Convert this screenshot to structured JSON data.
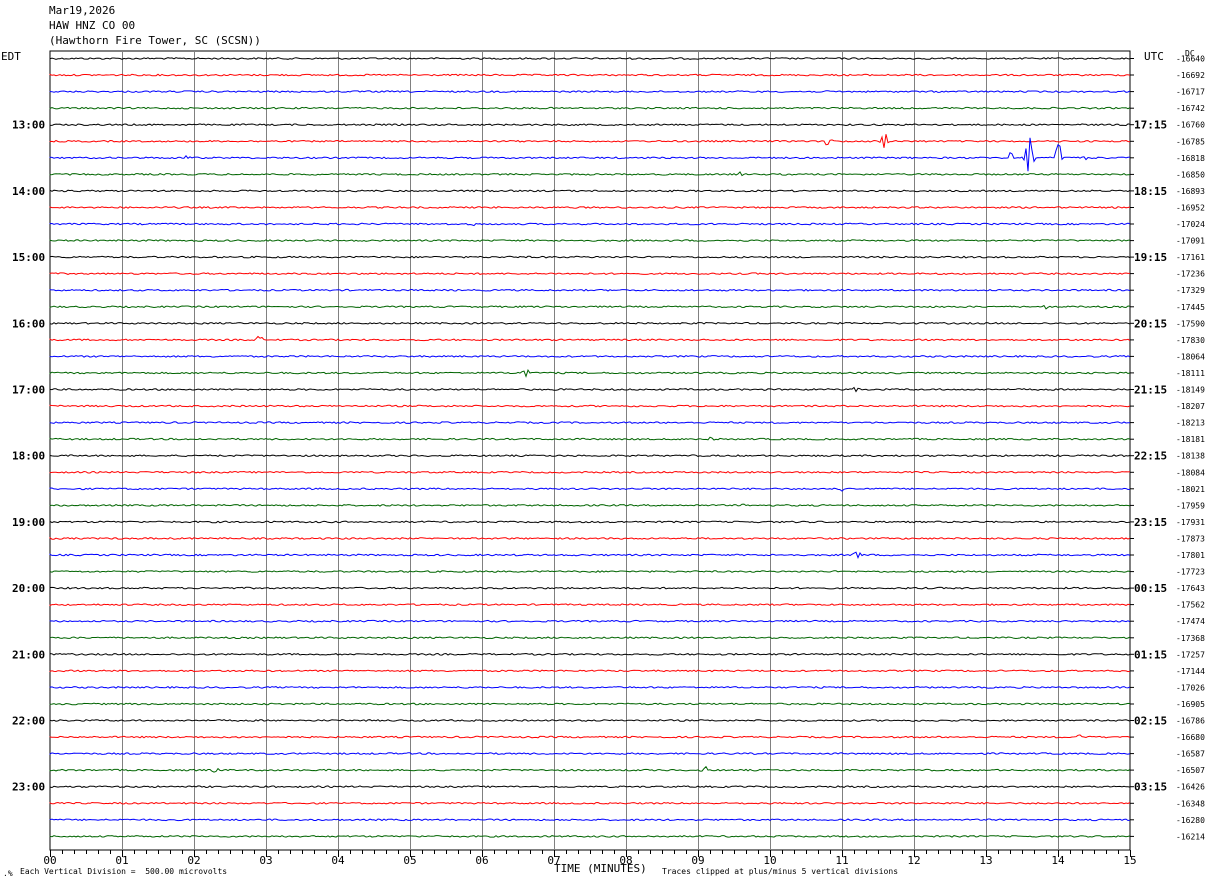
{
  "header": {
    "date": "Mar19,2026",
    "station": "HAW HNZ CO 00",
    "location": "(Hawthorn Fire Tower, SC (SCSN))"
  },
  "left_zone": "EDT",
  "right_zone": "UTC",
  "dc_label": "DC",
  "footer": {
    "scale": "Each Vertical Division =  500.00 microvolts",
    "xlabel": "TIME (MINUTES)",
    "clip": "Traces clipped at plus/minus 5 vertical divisions"
  },
  "colors": {
    "black": "#000000",
    "red": "#ff0000",
    "blue": "#0000ff",
    "green": "#006400",
    "grid": "#808080"
  },
  "chart_data": {
    "type": "line",
    "title": "HAW HNZ CO 00",
    "xlabel": "TIME (MINUTES)",
    "xlim": [
      0,
      15
    ],
    "x_ticks": [
      "00",
      "01",
      "02",
      "03",
      "04",
      "05",
      "06",
      "07",
      "08",
      "09",
      "10",
      "11",
      "12",
      "13",
      "14",
      "15"
    ],
    "left_hour_labels": [
      "13:00",
      "14:00",
      "15:00",
      "16:00",
      "17:00",
      "18:00",
      "19:00",
      "20:00",
      "21:00",
      "22:00",
      "23:00"
    ],
    "right_hour_labels": [
      "17:15",
      "18:15",
      "19:15",
      "20:15",
      "21:15",
      "22:15",
      "23:15",
      "00:15",
      "01:15",
      "02:15",
      "03:15"
    ],
    "trace_colors": [
      "black",
      "red",
      "blue",
      "green"
    ],
    "dc_offsets": [
      "-16640",
      "-16692",
      "-16717",
      "-16742",
      "-16760",
      "-16785",
      "-16818",
      "-16850",
      "-16893",
      "-16952",
      "-17024",
      "-17091",
      "-17161",
      "-17236",
      "-17329",
      "-17445",
      "-17590",
      "-17830",
      "-18064",
      "-18111",
      "-18149",
      "-18207",
      "-18213",
      "-18181",
      "-18138",
      "-18084",
      "-18021",
      "-17959",
      "-17931",
      "-17873",
      "-17801",
      "-17723",
      "-17643",
      "-17562",
      "-17474",
      "-17368",
      "-17257",
      "-17144",
      "-17026",
      "-16905",
      "-16786",
      "-16680",
      "-16587",
      "-16507",
      "-16426",
      "-16348",
      "-16280",
      "-16214"
    ],
    "events": [
      {
        "trace": 5,
        "minute": 10.8,
        "amp": 5
      },
      {
        "trace": 5,
        "minute": 11.6,
        "amp": 10
      },
      {
        "trace": 6,
        "minute": 1.9,
        "amp": 3
      },
      {
        "trace": 6,
        "minute": 13.35,
        "amp": 7
      },
      {
        "trace": 6,
        "minute": 13.6,
        "amp": 29
      },
      {
        "trace": 6,
        "minute": 14.0,
        "amp": 18
      },
      {
        "trace": 6,
        "minute": 14.4,
        "amp": 4
      },
      {
        "trace": 7,
        "minute": 9.6,
        "amp": 3
      },
      {
        "trace": 10,
        "minute": 5.9,
        "amp": 3
      },
      {
        "trace": 15,
        "minute": 13.85,
        "amp": 4
      },
      {
        "trace": 17,
        "minute": 2.9,
        "amp": 6
      },
      {
        "trace": 19,
        "minute": 6.6,
        "amp": 5
      },
      {
        "trace": 20,
        "minute": 11.2,
        "amp": 3
      },
      {
        "trace": 23,
        "minute": 9.2,
        "amp": 5
      },
      {
        "trace": 26,
        "minute": 11.0,
        "amp": 3
      },
      {
        "trace": 27,
        "minute": 9.6,
        "amp": 3
      },
      {
        "trace": 30,
        "minute": 11.2,
        "amp": 5
      },
      {
        "trace": 41,
        "minute": 14.3,
        "amp": 4
      },
      {
        "trace": 43,
        "minute": 9.1,
        "amp": 5
      },
      {
        "trace": 43,
        "minute": 2.3,
        "amp": 3
      }
    ]
  }
}
